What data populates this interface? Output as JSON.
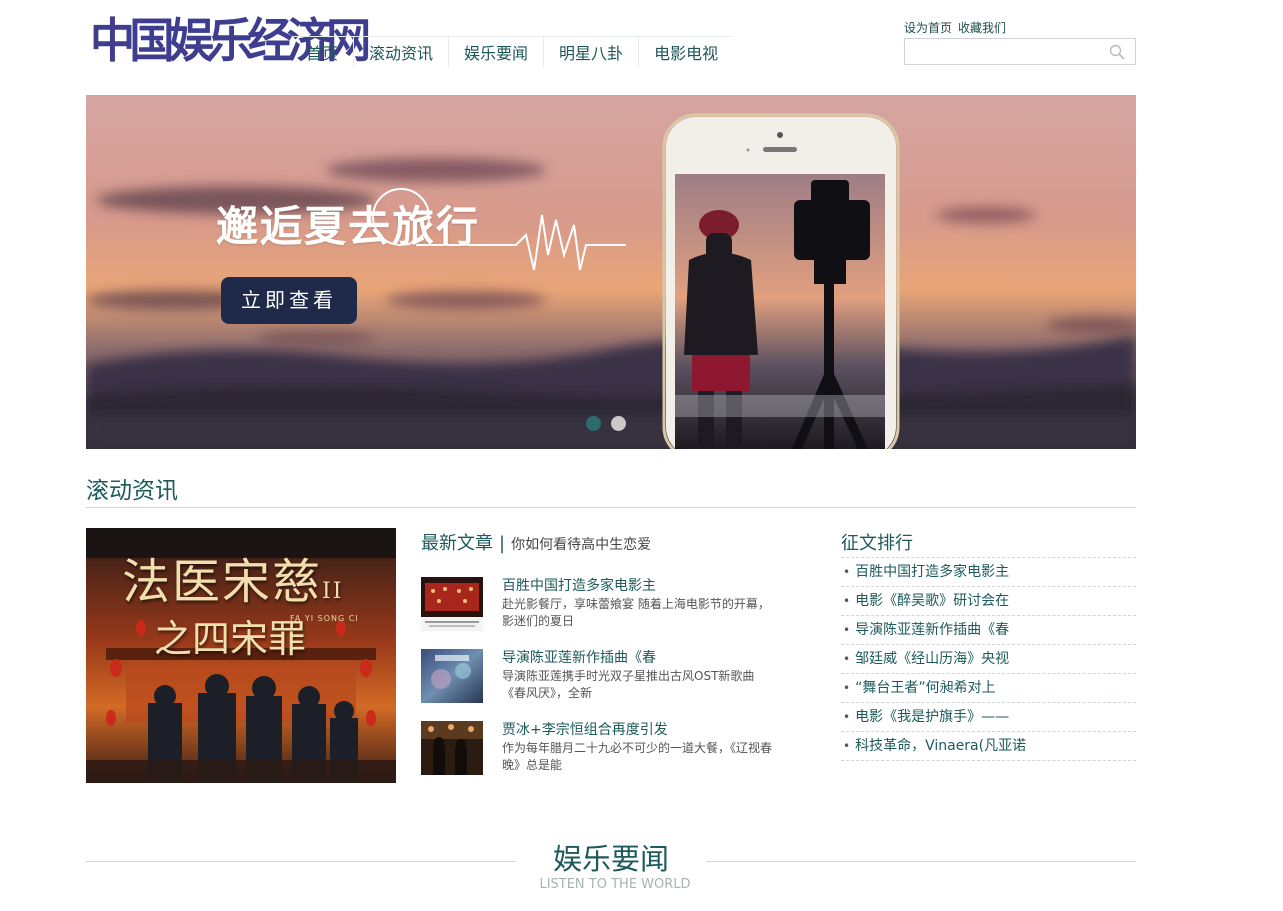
{
  "header": {
    "logo_text": "中国娱乐经济网",
    "nav": [
      "首页",
      "滚动资讯",
      "娱乐要闻",
      "明星八卦",
      "电影电视"
    ],
    "top_links": [
      "设为首页",
      "收藏我们"
    ],
    "search": {
      "placeholder": "",
      "value": ""
    }
  },
  "banner": {
    "heading": "邂逅夏去旅行",
    "button_label": "立即查看",
    "slide_count": 2,
    "active_slide": 1
  },
  "rolling": {
    "section_title": "滚动资讯",
    "poster": {
      "title": "法医宋慈",
      "number": "II",
      "subtitle": "之四宋罪",
      "tag": "FA YI SONG CI"
    },
    "latest": {
      "title": "最新文章",
      "separator": "|",
      "subtitle": "你如何看待高中生恋爱",
      "articles": [
        {
          "title": "百胜中国打造多家电影主",
          "desc": "赴光影餐厅，享味蕾飨宴 随着上海电影节的开幕，影迷们的夏日"
        },
        {
          "title": "导演陈亚莲新作插曲《春",
          "desc": "导演陈亚莲携手时光双子星推出古风OST新歌曲《春风厌》，全新"
        },
        {
          "title": "贾冰+李宗恒组合再度引发",
          "desc": "作为每年腊月二十九必不可少的一道大餐，《辽视春晚》总是能"
        }
      ]
    },
    "ranking": {
      "title": "征文排行",
      "bullet": "•",
      "items": [
        "百胜中国打造多家电影主",
        "电影《醉吴歌》研讨会在",
        "导演陈亚莲新作插曲《春",
        "邹廷威《经山历海》央视",
        "“舞台王者”何昶希对上",
        "电影《我是护旗手》——",
        "科技革命，Vinaera(凡亚诺"
      ]
    }
  },
  "ent_news": {
    "title": "娱乐要闻",
    "subtitle": "LISTEN TO THE WORLD"
  },
  "colors": {
    "logo": "#3e3d8f",
    "accent": "#1d5a5a",
    "button": "#1f2a4a",
    "dot_active": "#2f6b6b",
    "dot_inactive": "#c9c9c9"
  }
}
